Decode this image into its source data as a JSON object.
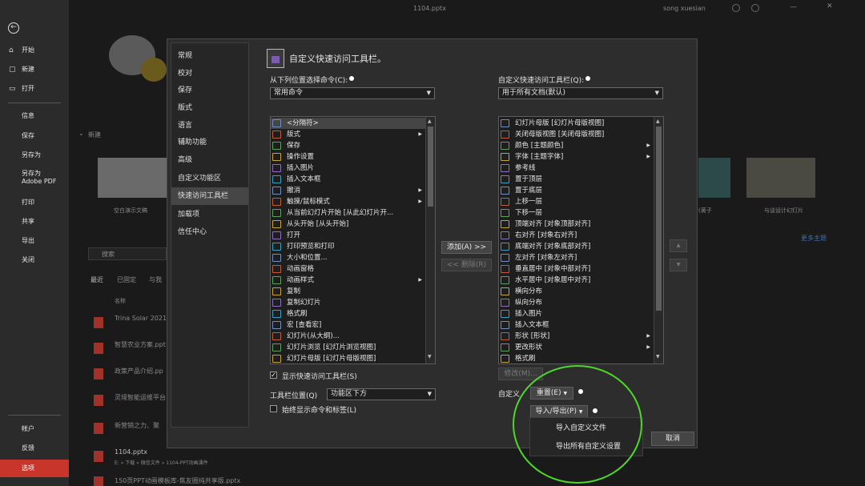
{
  "window": {
    "title": "1104.pptx",
    "user": "song xuesian"
  },
  "nav": {
    "back_glyph": "←",
    "items": [
      {
        "label": "开始",
        "icon": "home-icon",
        "glyph": "⌂"
      },
      {
        "label": "新建",
        "icon": "new-file-icon",
        "glyph": "▢"
      },
      {
        "label": "打开",
        "icon": "open-folder-icon",
        "glyph": "▭"
      },
      {
        "label": "信息"
      },
      {
        "label": "保存"
      },
      {
        "label": "另存为"
      },
      {
        "label": "另存为 Adobe PDF"
      },
      {
        "label": "打印"
      },
      {
        "label": "共享"
      },
      {
        "label": "导出"
      },
      {
        "label": "关闭"
      },
      {
        "label": "帐户"
      },
      {
        "label": "反馈"
      },
      {
        "label": "选项"
      }
    ]
  },
  "backstage": {
    "new_section": "新建",
    "thumb_labels": [
      "空白演示文稿",
      "(黄子",
      "与谈设计幻灯片"
    ],
    "more_themes": "更多主题",
    "search_placeholder": "搜索",
    "tabs": [
      "最近",
      "已固定",
      "与我"
    ],
    "name_header": "名称",
    "recent_files": [
      "Trina Solar 2021",
      "智慧农业方案.ppt",
      "政策产品介绍.pp",
      "灵境智能运维平台",
      "新营销之力、聚",
      "1104.pptx",
      "150页PPT动画模板库-焦友圈纯共享版.pptx"
    ],
    "recent_path": "E: » 下载 » 微信文件 » 1104-PPT动画课件"
  },
  "dialog": {
    "categories": [
      "常规",
      "校对",
      "保存",
      "版式",
      "语言",
      "辅助功能",
      "高级",
      "自定义功能区",
      "快速访问工具栏",
      "加载项",
      "信任中心"
    ],
    "selected_category": 8,
    "heading": "自定义快速访问工具栏。",
    "choose_label": "从下列位置选择命令(C):",
    "choose_value": "常用命令",
    "customize_label": "自定义快速访问工具栏(Q):",
    "customize_value": "用于所有文档(默认)",
    "left_commands": [
      {
        "label": "<分隔符>",
        "sub": false
      },
      {
        "label": "版式",
        "sub": true
      },
      {
        "label": "保存",
        "sub": false
      },
      {
        "label": "操作设置",
        "sub": false
      },
      {
        "label": "插入图片",
        "sub": false
      },
      {
        "label": "插入文本框",
        "sub": false
      },
      {
        "label": "撤消",
        "sub": true
      },
      {
        "label": "触摸/鼠标模式",
        "sub": true
      },
      {
        "label": "从当前幻灯片开始 [从此幻灯片开...",
        "sub": false
      },
      {
        "label": "从头开始 [从头开始]",
        "sub": false
      },
      {
        "label": "打开",
        "sub": false
      },
      {
        "label": "打印预览和打印",
        "sub": false
      },
      {
        "label": "大小和位置...",
        "sub": false
      },
      {
        "label": "动画窗格",
        "sub": false
      },
      {
        "label": "动画样式",
        "sub": true
      },
      {
        "label": "复制",
        "sub": false
      },
      {
        "label": "复制幻灯片",
        "sub": false
      },
      {
        "label": "格式刷",
        "sub": false
      },
      {
        "label": "宏 [查看宏]",
        "sub": false
      },
      {
        "label": "幻灯片(从大纲)...",
        "sub": false
      },
      {
        "label": "幻灯片浏览 [幻灯片浏览视图]",
        "sub": false
      },
      {
        "label": "幻灯片母版 [幻灯片母版视图]",
        "sub": false
      }
    ],
    "right_commands": [
      {
        "label": "幻灯片母版 [幻灯片母版视图]",
        "sub": false
      },
      {
        "label": "关闭母版视图 [关闭母版视图]",
        "sub": false
      },
      {
        "label": "颜色 [主题颜色]",
        "sub": true
      },
      {
        "label": "字体 [主题字体]",
        "sub": true
      },
      {
        "label": "参考线",
        "sub": false
      },
      {
        "label": "置于顶层",
        "sub": false
      },
      {
        "label": "置于底层",
        "sub": false
      },
      {
        "label": "上移一层",
        "sub": false
      },
      {
        "label": "下移一层",
        "sub": false
      },
      {
        "label": "顶端对齐 [对象顶部对齐]",
        "sub": false
      },
      {
        "label": "右对齐 [对象右对齐]",
        "sub": false
      },
      {
        "label": "底端对齐 [对象底部对齐]",
        "sub": false
      },
      {
        "label": "左对齐 [对象左对齐]",
        "sub": false
      },
      {
        "label": "垂直居中 [对象中部对齐]",
        "sub": false
      },
      {
        "label": "水平居中 [对象居中对齐]",
        "sub": false
      },
      {
        "label": "横向分布",
        "sub": false
      },
      {
        "label": "纵向分布",
        "sub": false
      },
      {
        "label": "插入图片",
        "sub": false
      },
      {
        "label": "插入文本框",
        "sub": false
      },
      {
        "label": "形状 [形状]",
        "sub": true
      },
      {
        "label": "更改形状",
        "sub": true
      },
      {
        "label": "格式刷",
        "sub": false
      }
    ],
    "add_button": "添加(A) >>",
    "remove_button": "<< 删除(R)",
    "up_glyph": "▲",
    "down_glyph": "▼",
    "modify_button": "修改(M)...",
    "show_qat_label": "显示快速访问工具栏(S)",
    "show_qat_checked": true,
    "position_label": "工具栏位置(Q)",
    "position_value": "功能区下方",
    "always_show_label": "始终显示命令和标签(L)",
    "always_show_checked": false,
    "customizations_label": "自定义",
    "reset_button": "重置(E)",
    "import_export_button": "导入/导出(P)",
    "cancel_button": "取消",
    "popup_items": [
      "导入自定义文件",
      "导出所有自定义设置"
    ]
  },
  "colors": {
    "accent_red": "#c8362b",
    "highlight_green": "#4fd62a"
  }
}
